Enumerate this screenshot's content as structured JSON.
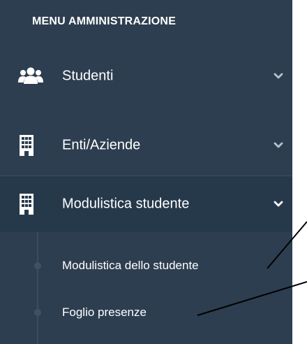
{
  "menu": {
    "header": "MENU AMMINISTRAZIONE",
    "items": [
      {
        "label": "Studenti",
        "icon": "users-icon",
        "expanded": false
      },
      {
        "label": "Enti/Aziende",
        "icon": "building-icon",
        "expanded": false
      },
      {
        "label": "Modulistica studente",
        "icon": "building-icon",
        "expanded": true,
        "subitems": [
          {
            "label": "Modulistica dello studente"
          },
          {
            "label": "Foglio presenze"
          }
        ]
      }
    ]
  },
  "colors": {
    "sidebar_bg": "#2d3e50",
    "active_bg": "#26394b",
    "text": "#ffffff",
    "chevron": "#b8c2cc"
  }
}
